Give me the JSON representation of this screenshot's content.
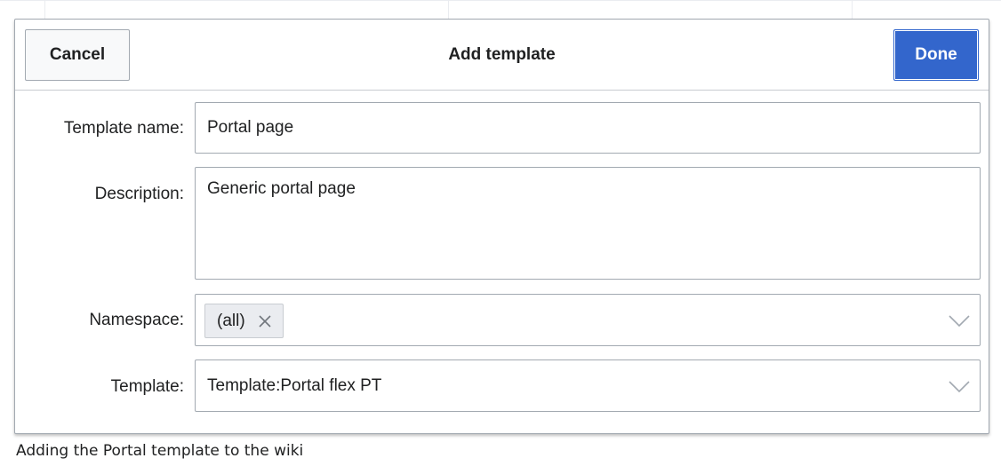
{
  "dialog": {
    "title": "Add template",
    "cancel_label": "Cancel",
    "done_label": "Done",
    "accent_color": "#3366cc"
  },
  "form": {
    "template_name": {
      "label": "Template name:",
      "value": "Portal page"
    },
    "description": {
      "label": "Description:",
      "value": "Generic portal page"
    },
    "namespace": {
      "label": "Namespace:",
      "chips": [
        "(all)"
      ],
      "remove_icon": "close-icon",
      "dropdown_icon": "chevron-down-icon"
    },
    "template": {
      "label": "Template:",
      "value": "Template:Portal flex PT",
      "dropdown_icon": "chevron-down-icon"
    }
  },
  "caption": "Adding the Portal template to the wiki"
}
